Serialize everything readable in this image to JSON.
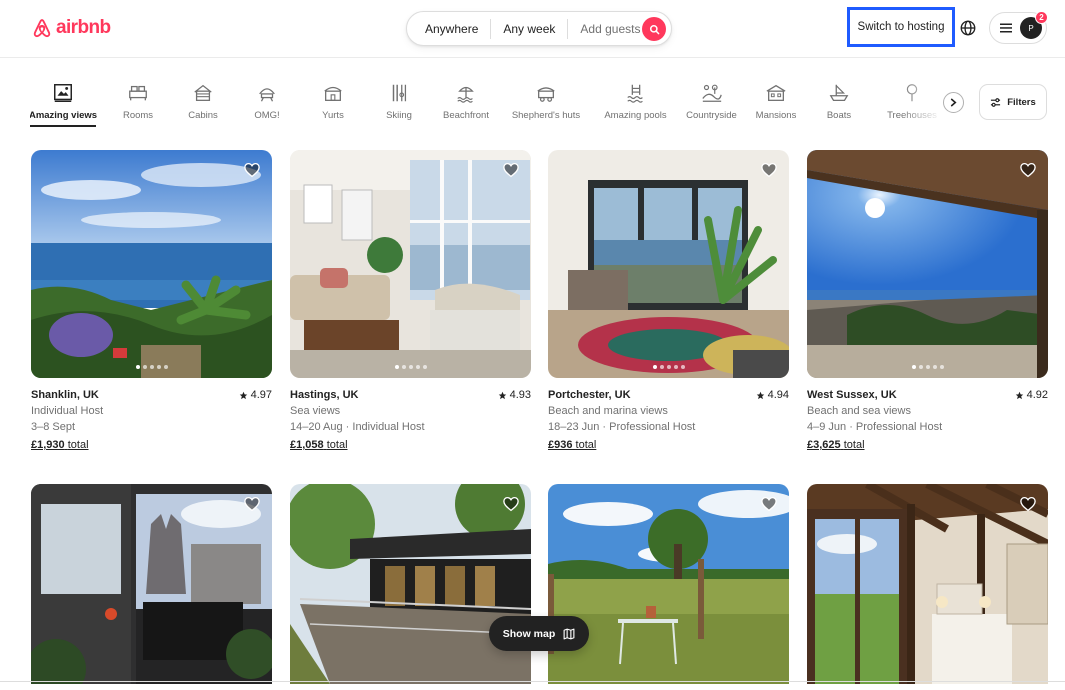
{
  "brand": {
    "name": "airbnb",
    "color": "#ff385c"
  },
  "search": {
    "location": "Anywhere",
    "dates": "Any week",
    "guests": "Add guests"
  },
  "header": {
    "switch_hosting": "Switch to hosting",
    "notification_count": "2",
    "avatar_initial": "P"
  },
  "categories": [
    {
      "label": "Amazing views",
      "icon": "amazing-views-icon",
      "active": true
    },
    {
      "label": "Rooms",
      "icon": "rooms-icon"
    },
    {
      "label": "Cabins",
      "icon": "cabins-icon"
    },
    {
      "label": "OMG!",
      "icon": "omg-icon"
    },
    {
      "label": "Yurts",
      "icon": "yurts-icon"
    },
    {
      "label": "Skiing",
      "icon": "skiing-icon"
    },
    {
      "label": "Beachfront",
      "icon": "beachfront-icon"
    },
    {
      "label": "Shepherd's huts",
      "icon": "shepherds-huts-icon"
    },
    {
      "label": "Amazing pools",
      "icon": "amazing-pools-icon"
    },
    {
      "label": "Countryside",
      "icon": "countryside-icon"
    },
    {
      "label": "Mansions",
      "icon": "mansions-icon"
    },
    {
      "label": "Boats",
      "icon": "boats-icon"
    },
    {
      "label": "Treehouses",
      "icon": "treehouses-icon"
    }
  ],
  "filters_label": "Filters",
  "listings": [
    {
      "location": "Shanklin, UK",
      "rating": "4.97",
      "line1": "Individual Host",
      "line2": "3–8 Sept",
      "price": "£1,930",
      "price_suffix": "total"
    },
    {
      "location": "Hastings, UK",
      "rating": "4.93",
      "line1": "Sea views",
      "line2": "14–20 Aug · Individual Host",
      "price": "£1,058",
      "price_suffix": "total"
    },
    {
      "location": "Portchester, UK",
      "rating": "4.94",
      "line1": "Beach and marina views",
      "line2": "18–23 Jun · Professional Host",
      "price": "£936",
      "price_suffix": "total"
    },
    {
      "location": "West Sussex, UK",
      "rating": "4.92",
      "line1": "Beach and sea views",
      "line2": "4–9 Jun · Professional Host",
      "price": "£3,625",
      "price_suffix": "total"
    }
  ],
  "show_map": "Show map"
}
